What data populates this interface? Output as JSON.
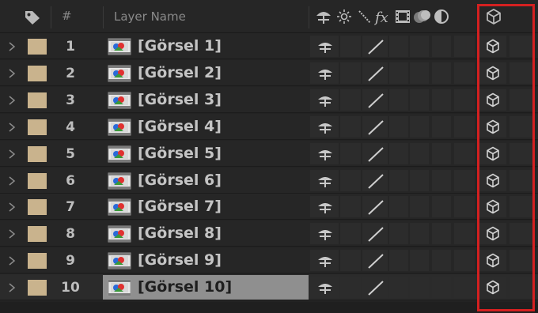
{
  "header": {
    "number_label": "#",
    "layer_name_label": "Layer Name",
    "label_icon": "tag-icon",
    "switch_icons": [
      "shy-icon",
      "collapse-sun-icon",
      "quality-icon",
      "fx-icon",
      "frame-blend-icon",
      "motion-blur-icon",
      "adjustment-icon",
      "3d-cube-icon"
    ]
  },
  "layers": [
    {
      "number": "1",
      "name": "[Görsel 1]",
      "selected": false
    },
    {
      "number": "2",
      "name": "[Görsel 2]",
      "selected": false
    },
    {
      "number": "3",
      "name": "[Görsel 3]",
      "selected": false
    },
    {
      "number": "4",
      "name": "[Görsel 4]",
      "selected": false
    },
    {
      "number": "5",
      "name": "[Görsel 5]",
      "selected": false
    },
    {
      "number": "6",
      "name": "[Görsel 6]",
      "selected": false
    },
    {
      "number": "7",
      "name": "[Görsel 7]",
      "selected": false
    },
    {
      "number": "8",
      "name": "[Görsel 8]",
      "selected": false
    },
    {
      "number": "9",
      "name": "[Görsel 9]",
      "selected": false
    },
    {
      "number": "10",
      "name": "[Görsel 10]",
      "selected": true
    }
  ],
  "colors": {
    "label_swatch": "#c9b38d",
    "highlight": "#d42020",
    "selected_name_bg": "#8f8f8f"
  }
}
